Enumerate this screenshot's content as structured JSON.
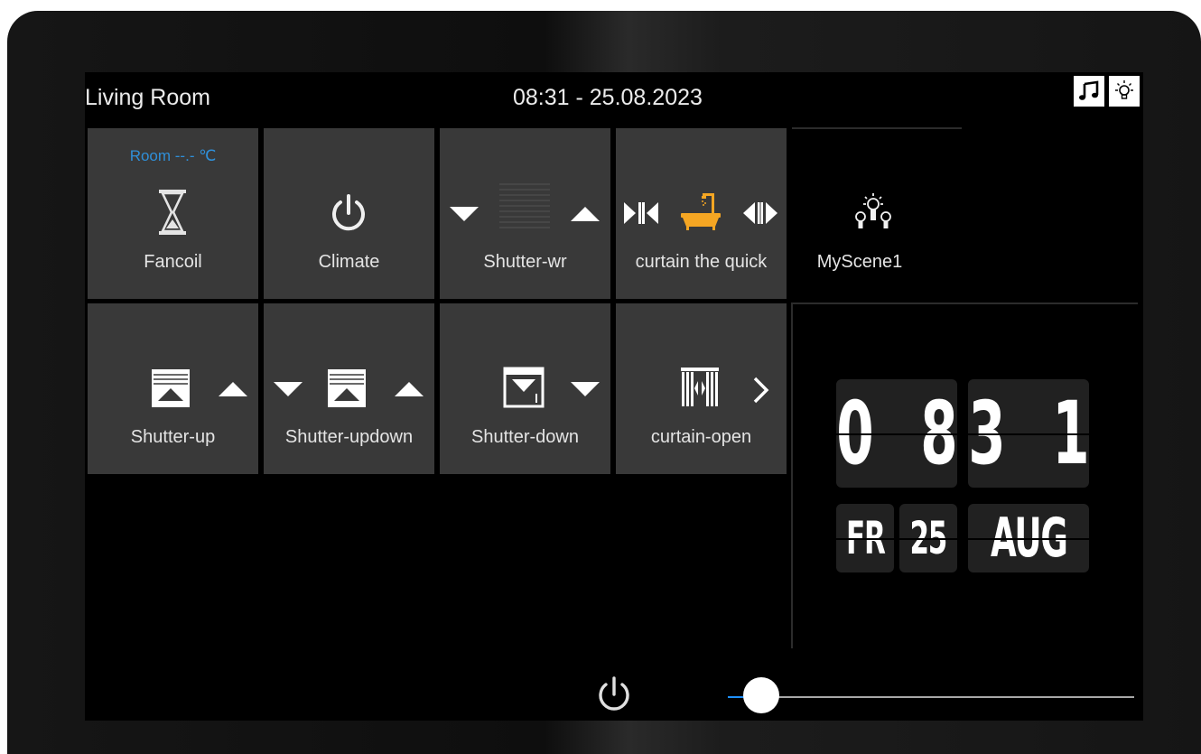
{
  "header": {
    "room_name": "Living Room",
    "datetime": "08:31 - 25.08.2023",
    "icons": [
      "music-icon",
      "light-bulb-icon"
    ]
  },
  "tiles": [
    {
      "label": "Fancoil",
      "sublabel": "Room --.- ℃",
      "icon": "hourglass-icon"
    },
    {
      "label": "Climate",
      "icon": "power-icon"
    },
    {
      "label": "Shutter-wr",
      "icons": [
        "arrow-down-icon",
        "shutter-icon",
        "arrow-up-icon"
      ]
    },
    {
      "label": "curtain the quick",
      "icons": [
        "curtain-close-icon",
        "bathtub-icon",
        "curtain-open-icon"
      ]
    },
    {
      "label": "Shutter-up",
      "icons": [
        "shutter-up-icon",
        "arrow-up-icon"
      ]
    },
    {
      "label": "Shutter-updown",
      "icons": [
        "arrow-down-icon",
        "shutter-up-icon",
        "arrow-up-icon"
      ]
    },
    {
      "label": "Shutter-down",
      "icons": [
        "shutter-down-icon",
        "arrow-down-icon"
      ]
    },
    {
      "label": "curtain-open",
      "icons": [
        "curtain-icon",
        "chevron-right-icon"
      ]
    }
  ],
  "scene": {
    "label": "MyScene1",
    "icon": "scene-bulbs-icon"
  },
  "flip_clock": {
    "hour_tens": "0",
    "hour_ones": "8",
    "minute_tens": "3",
    "minute_ones": "1",
    "weekday": "FR",
    "day": "25",
    "month": "AUG"
  },
  "footer": {
    "power_icon": "power-icon",
    "slider_value_fraction": 0.08,
    "colors": {
      "accent": "#1e90ff",
      "temp_text": "#2f8fd8",
      "bathtub": "#f5a623"
    }
  }
}
